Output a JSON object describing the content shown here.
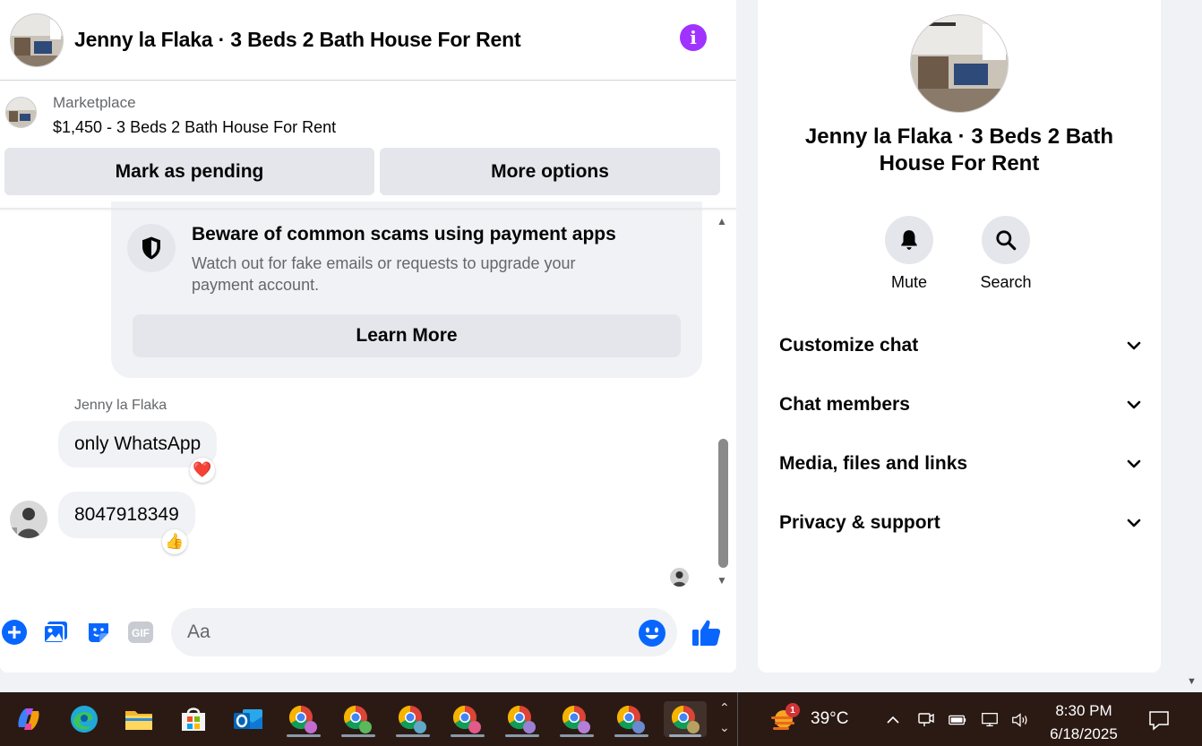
{
  "chat": {
    "title": "Jenny la Flaka · 3 Beds 2 Bath House For Rent",
    "marketplace_label": "Marketplace",
    "listing": "$1,450 - 3 Beds 2 Bath House For Rent",
    "buttons": {
      "pending": "Mark as pending",
      "options": "More options"
    },
    "info_icon": "info-icon"
  },
  "scam_notice": {
    "title": "Beware of common scams using payment apps",
    "text": "Watch out for fake emails or requests to upgrade your payment account.",
    "button": "Learn More"
  },
  "messages": [
    {
      "sender": "Jenny la Flaka",
      "text": "only WhatsApp",
      "reaction": "❤️"
    },
    {
      "text": "8047918349",
      "reaction": "👍"
    }
  ],
  "composer": {
    "placeholder": "Aa",
    "gif_label": "GIF"
  },
  "details": {
    "title": "Jenny la Flaka · 3 Beds 2 Bath House For Rent",
    "actions": {
      "mute": "Mute",
      "search": "Search"
    },
    "sections": [
      "Customize chat",
      "Chat members",
      "Media, files and links",
      "Privacy & support"
    ]
  },
  "taskbar": {
    "weather": {
      "temp": "39°C",
      "badge": "1"
    },
    "time": "8:30 PM",
    "date": "6/18/2025"
  },
  "colors": {
    "accent": "#0866ff",
    "info": "#a033ff",
    "heart": "#e41e3f",
    "taskbar": "#2b1a14"
  }
}
